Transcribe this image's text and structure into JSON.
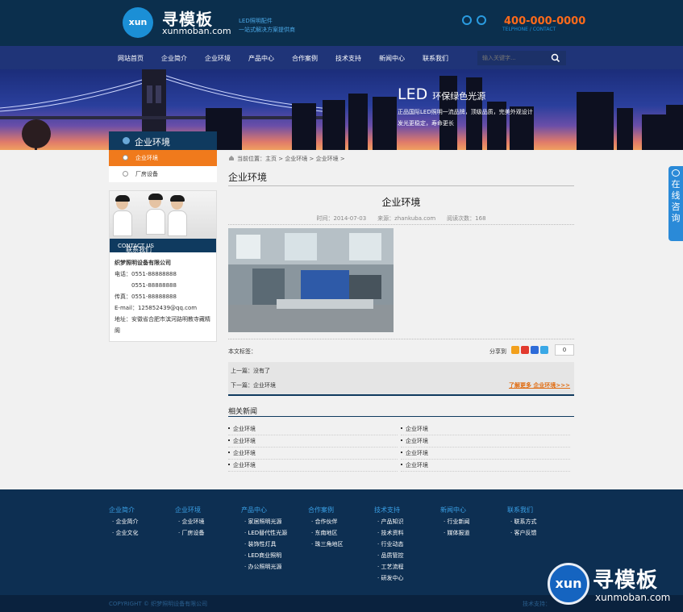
{
  "header": {
    "logo_mark": "xun",
    "logo_cn": "寻模板",
    "logo_en": "xunmoban.com",
    "slogan": [
      "LED照明配件",
      "一站式解决方案提供商"
    ],
    "phone": "400-000-0000",
    "phone_sub": "TELPHONE / CONTACT"
  },
  "nav": {
    "items": [
      "网站首页",
      "企业简介",
      "企业环境",
      "产品中心",
      "合作案例",
      "技术支持",
      "新闻中心",
      "联系我们"
    ],
    "search_placeholder": "输入关键字..."
  },
  "banner": {
    "title_big": "LED",
    "title_small": "环保绿色光源",
    "sub": [
      "正品国际LED照明一流品牌，顶级品质，完美外观设计",
      "发光更稳定，寿命更长"
    ]
  },
  "sidebar": {
    "title": "企业环境",
    "items": [
      {
        "label": "企业环境",
        "active": true
      },
      {
        "label": "厂房设备",
        "active": false
      }
    ],
    "contact_title": "联系我们",
    "contact_title_en": "CONTACT US",
    "company": "织梦照明设备有限公司",
    "lines": [
      "电话：0551-88888888",
      "　　　0551-88888888",
      "传真：0551-88888888",
      "E-mail：125852439@qq.com",
      "地址：安徽省合肥市滨河路明教寺藏精",
      "阁"
    ]
  },
  "main": {
    "breadcrumb": "当前位置：主页 > 企业环境 > 企业环境 >",
    "page_title": "企业环境",
    "article_title": "企业环境",
    "meta": "时间：2014-07-03　　来源：zhankuba.com　　阅读次数：168",
    "tags_label": "本文标签：",
    "share_label": "分享到",
    "share_count": "0",
    "prev": "上一篇：没有了",
    "next": "下一篇：企业环境",
    "more": "了解更多 企业环境>>>",
    "related_title": "相关新闻",
    "related": [
      "企业环境",
      "企业环境",
      "企业环境",
      "企业环境",
      "企业环境",
      "企业环境",
      "企业环境",
      "企业环境"
    ]
  },
  "footer": {
    "cols": [
      {
        "title": "企业简介",
        "items": [
          "企业简介",
          "企业文化"
        ]
      },
      {
        "title": "企业环境",
        "items": [
          "企业环境",
          "厂房设备"
        ]
      },
      {
        "title": "产品中心",
        "items": [
          "家居照明光源",
          "LED替代性光源",
          "装饰性灯具",
          "LED商业照明",
          "办公照明光源"
        ]
      },
      {
        "title": "合作案例",
        "items": [
          "合作伙伴",
          "东南地区",
          "珠三角地区"
        ]
      },
      {
        "title": "技术支持",
        "items": [
          "产品知识",
          "技术资料",
          "行业动态",
          "品质管控",
          "工艺流程",
          "研发中心"
        ]
      },
      {
        "title": "新闻中心",
        "items": [
          "行业新闻",
          "媒体报道"
        ]
      },
      {
        "title": "联系我们",
        "items": [
          "联系方式",
          "客户反馈"
        ]
      }
    ],
    "copyright": "COPYRIGHT © 织梦照明设备有限公司",
    "right_text": "技术支持："
  },
  "float_chat": "在线咨询",
  "watermark": {
    "mark": "xun",
    "cn": "寻模板",
    "en": "xunmoban.com"
  },
  "colors": {
    "accent": "#f07a1c",
    "nav": "#1f3478",
    "dark": "#0f3a5f"
  }
}
